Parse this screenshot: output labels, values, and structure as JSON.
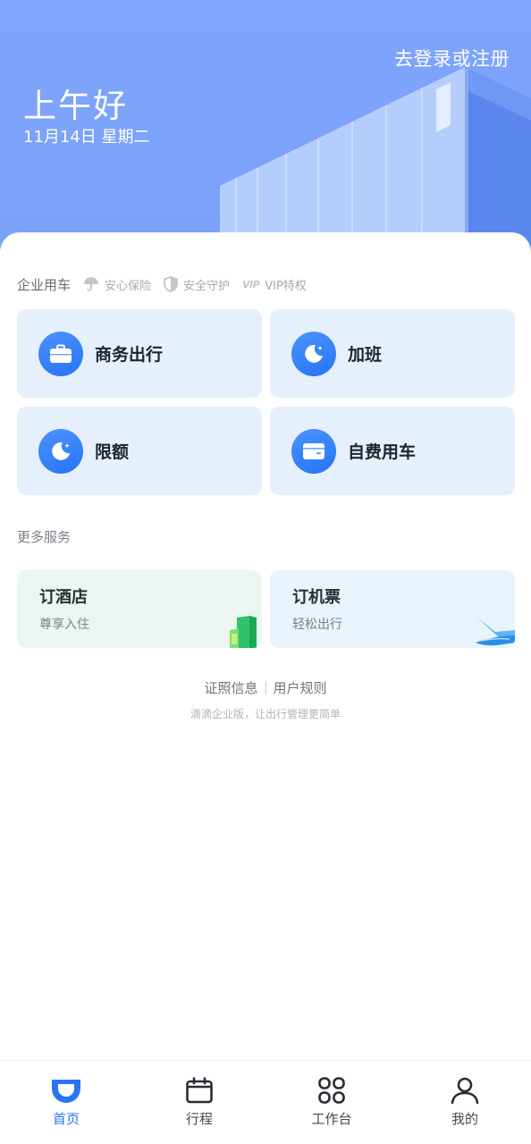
{
  "header": {
    "login_link": "去登录或注册",
    "greeting": "上午好",
    "date": "11月14日 星期二"
  },
  "tagline": {
    "title": "企业用车",
    "items": [
      {
        "label": "安心保险",
        "icon": "umbrella-icon"
      },
      {
        "label": "安全守护",
        "icon": "shield-icon"
      },
      {
        "label": "VIP特权",
        "icon": "vip-icon",
        "mark": "VIP"
      }
    ]
  },
  "services": [
    {
      "label": "商务出行",
      "icon": "briefcase-icon"
    },
    {
      "label": "加班",
      "icon": "moon-icon"
    },
    {
      "label": "限额",
      "icon": "moon-icon"
    },
    {
      "label": "自费用车",
      "icon": "card-icon"
    }
  ],
  "more": {
    "title": "更多服务",
    "cards": [
      {
        "name": "订酒店",
        "sub": "尊享入住",
        "icon": "hotel-building-icon"
      },
      {
        "name": "订机票",
        "sub": "轻松出行",
        "icon": "airplane-icon"
      }
    ]
  },
  "footer": {
    "links": [
      "证照信息",
      "用户规则"
    ],
    "slogan": "滴滴企业版，让出行管理更简单"
  },
  "tabs": [
    {
      "label": "首页",
      "icon": "home-icon",
      "active": true
    },
    {
      "label": "行程",
      "icon": "calendar-icon",
      "active": false
    },
    {
      "label": "工作台",
      "icon": "apps-grid-icon",
      "active": false
    },
    {
      "label": "我的",
      "icon": "user-icon",
      "active": false
    }
  ],
  "colors": {
    "header_bg": "#7ea5fb",
    "accent": "#2a73f3",
    "service_card_bg": "#e6f0fd",
    "hotel_card_bg": "#eaf6ef",
    "flight_card_bg": "#e8f3fb"
  }
}
